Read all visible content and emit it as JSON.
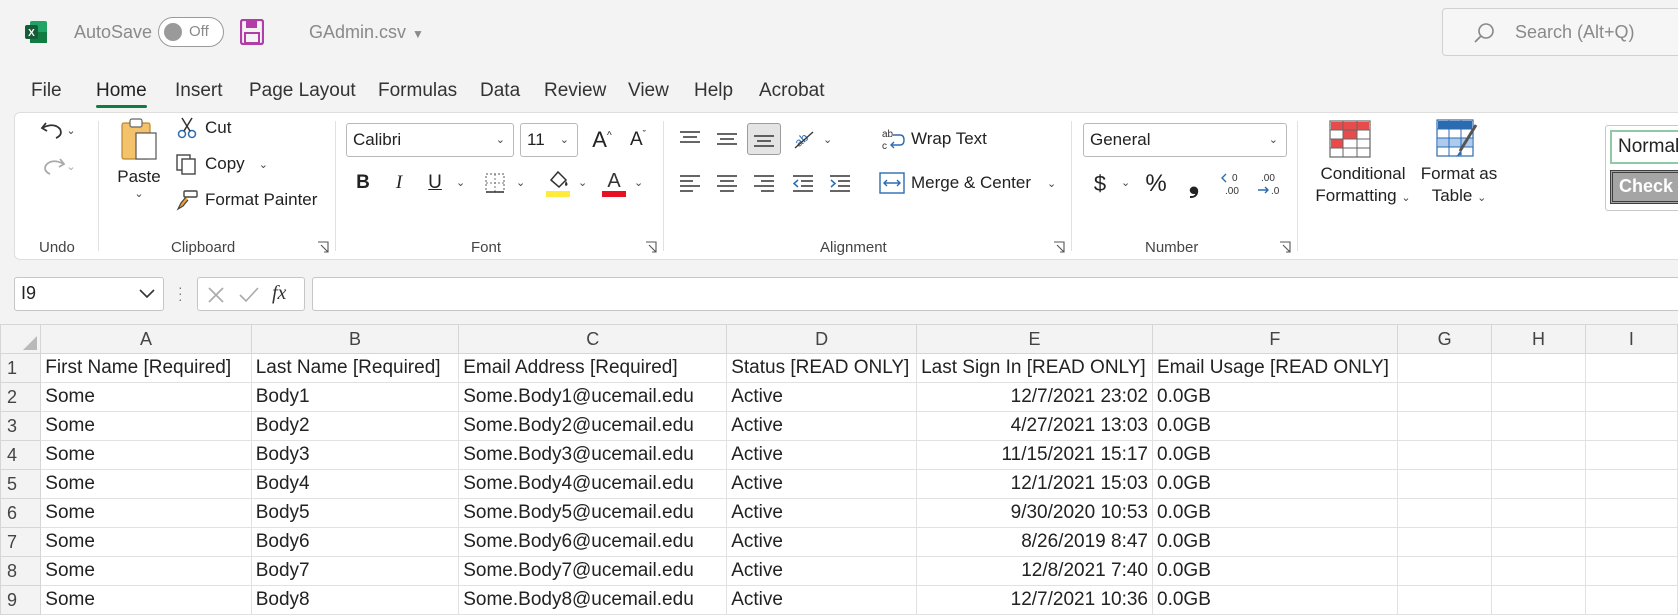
{
  "titlebar": {
    "autosave_label": "AutoSave",
    "autosave_state": "Off",
    "filename": "GAdmin.csv",
    "search_placeholder": "Search (Alt+Q)",
    "brand_color": "#107c41"
  },
  "tabs": [
    {
      "label": "File"
    },
    {
      "label": "Home"
    },
    {
      "label": "Insert"
    },
    {
      "label": "Page Layout"
    },
    {
      "label": "Formulas"
    },
    {
      "label": "Data"
    },
    {
      "label": "Review"
    },
    {
      "label": "View"
    },
    {
      "label": "Help"
    },
    {
      "label": "Acrobat"
    }
  ],
  "ribbon": {
    "undo_group": "Undo",
    "clipboard": {
      "group": "Clipboard",
      "paste": "Paste",
      "cut": "Cut",
      "copy": "Copy",
      "format_painter": "Format Painter"
    },
    "font": {
      "group": "Font",
      "name": "Calibri",
      "size": "11"
    },
    "alignment": {
      "group": "Alignment",
      "wrap_text": "Wrap Text",
      "merge_center": "Merge & Center"
    },
    "number": {
      "group": "Number",
      "format": "General"
    },
    "styles": {
      "conditional_1": "Conditional",
      "conditional_2": "Formatting",
      "format_table_1": "Format as",
      "format_table_2": "Table",
      "normal": "Normal",
      "check": "Check"
    }
  },
  "formula_bar": {
    "name_box": "I9",
    "content": ""
  },
  "sheet": {
    "columns": [
      "A",
      "B",
      "C",
      "D",
      "E",
      "F",
      "G",
      "H",
      "I"
    ],
    "rows": [
      {
        "n": "1",
        "cells": [
          "First Name [Required]",
          "Last Name [Required]",
          "Email Address [Required]",
          "Status [READ ONLY]",
          "Last Sign In [READ ONLY]",
          "Email Usage [READ ONLY]",
          "",
          "",
          ""
        ]
      },
      {
        "n": "2",
        "cells": [
          "Some",
          "Body1",
          "Some.Body1@ucemail.edu",
          "Active",
          "12/7/2021 23:02",
          "0.0GB",
          "",
          "",
          ""
        ]
      },
      {
        "n": "3",
        "cells": [
          "Some",
          "Body2",
          "Some.Body2@ucemail.edu",
          "Active",
          "4/27/2021 13:03",
          "0.0GB",
          "",
          "",
          ""
        ]
      },
      {
        "n": "4",
        "cells": [
          "Some",
          "Body3",
          "Some.Body3@ucemail.edu",
          "Active",
          "11/15/2021 15:17",
          "0.0GB",
          "",
          "",
          ""
        ]
      },
      {
        "n": "5",
        "cells": [
          "Some",
          "Body4",
          "Some.Body4@ucemail.edu",
          "Active",
          "12/1/2021 15:03",
          "0.0GB",
          "",
          "",
          ""
        ]
      },
      {
        "n": "6",
        "cells": [
          "Some",
          "Body5",
          "Some.Body5@ucemail.edu",
          "Active",
          "9/30/2020 10:53",
          "0.0GB",
          "",
          "",
          ""
        ]
      },
      {
        "n": "7",
        "cells": [
          "Some",
          "Body6",
          "Some.Body6@ucemail.edu",
          "Active",
          "8/26/2019 8:47",
          "0.0GB",
          "",
          "",
          ""
        ]
      },
      {
        "n": "8",
        "cells": [
          "Some",
          "Body7",
          "Some.Body7@ucemail.edu",
          "Active",
          "12/8/2021 7:40",
          "0.0GB",
          "",
          "",
          ""
        ]
      },
      {
        "n": "9",
        "cells": [
          "Some",
          "Body8",
          "Some.Body8@ucemail.edu",
          "Active",
          "12/7/2021 10:36",
          "0.0GB",
          "",
          "",
          ""
        ]
      }
    ]
  }
}
